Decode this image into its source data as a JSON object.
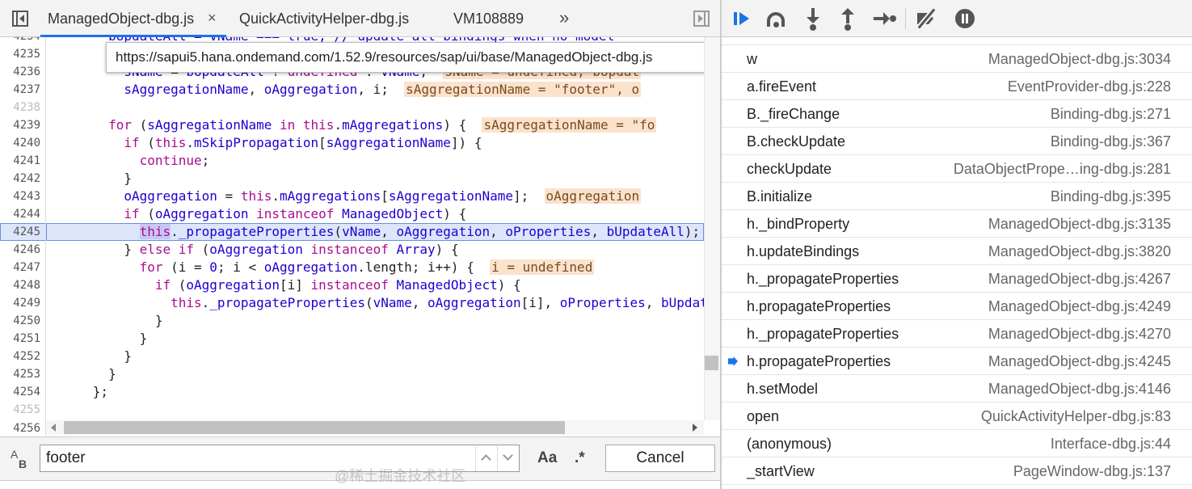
{
  "editor": {
    "tabs": [
      {
        "label": "ManagedObject-dbg.js",
        "active": true,
        "closable": true,
        "close_glyph": "×"
      },
      {
        "label": "QuickActivityHelper-dbg.js"
      },
      {
        "label": "VM108889"
      }
    ],
    "more_tabs_glyph": "»",
    "tooltip_url": "https://sapui5.hana.ondemand.com/1.52.9/resources/sap/ui/base/ManagedObject-dbg.js",
    "partial_top_line": "bUpdateAll = vName === true; // update all bindings when no model",
    "line_numbers": [
      "4234",
      "4235",
      "4236",
      "4237",
      "4238",
      "4239",
      "4240",
      "4241",
      "4242",
      "4243",
      "4244",
      "4245",
      "4246",
      "4247",
      "4248",
      "4249",
      "4250",
      "4251",
      "4252",
      "4253",
      "4254",
      "4255",
      "4256"
    ],
    "current_line": "4245",
    "inline_values": {
      "l4236": "sName = undefined, bUpdat",
      "l4237": "sAggregationName = \"footer\", o",
      "l4239": "sAggregationName = \"fo",
      "l4243": "oAggregation",
      "l4247": "i = undefined"
    }
  },
  "search": {
    "value": "footer",
    "prev_label": "previous-match",
    "next_label": "next-match",
    "match_case_label": "Aa",
    "regex_label": ".*",
    "cancel_label": "Cancel"
  },
  "call_stack": [
    {
      "fn": "w",
      "loc": "ManagedObject-dbg.js:3034"
    },
    {
      "fn": "a.fireEvent",
      "loc": "EventProvider-dbg.js:228"
    },
    {
      "fn": "B._fireChange",
      "loc": "Binding-dbg.js:271"
    },
    {
      "fn": "B.checkUpdate",
      "loc": "Binding-dbg.js:367"
    },
    {
      "fn": "checkUpdate",
      "loc": "DataObjectPrope…ing-dbg.js:281"
    },
    {
      "fn": "B.initialize",
      "loc": "Binding-dbg.js:395"
    },
    {
      "fn": "h._bindProperty",
      "loc": "ManagedObject-dbg.js:3135"
    },
    {
      "fn": "h.updateBindings",
      "loc": "ManagedObject-dbg.js:3820"
    },
    {
      "fn": "h._propagateProperties",
      "loc": "ManagedObject-dbg.js:4267"
    },
    {
      "fn": "h.propagateProperties",
      "loc": "ManagedObject-dbg.js:4249"
    },
    {
      "fn": "h._propagateProperties",
      "loc": "ManagedObject-dbg.js:4270"
    },
    {
      "fn": "h.propagateProperties",
      "loc": "ManagedObject-dbg.js:4245",
      "current": true
    },
    {
      "fn": "h.setModel",
      "loc": "ManagedObject-dbg.js:4146"
    },
    {
      "fn": "open",
      "loc": "QuickActivityHelper-dbg.js:83"
    },
    {
      "fn": "(anonymous)",
      "loc": "Interface-dbg.js:44"
    },
    {
      "fn": "_startView",
      "loc": "PageWindow-dbg.js:137"
    }
  ],
  "watermark": "@稀土掘金技术社区",
  "colors": {
    "keyword": "#aa0d91",
    "variable": "#1c00cf",
    "inline_value_bg": "#fbe2cd",
    "exec_line_bg": "#dde5fb",
    "accent": "#1a73e8"
  },
  "icons": [
    "navigator-toggle-icon",
    "close-icon",
    "more-tabs-icon",
    "debugger-toggle-icon",
    "search-case-icon",
    "chevron-up-icon",
    "chevron-down-icon",
    "resume-icon",
    "step-over-icon",
    "step-into-icon",
    "step-out-icon",
    "step-icon",
    "deactivate-breakpoints-icon",
    "pause-on-exceptions-icon",
    "current-frame-arrow-icon"
  ]
}
